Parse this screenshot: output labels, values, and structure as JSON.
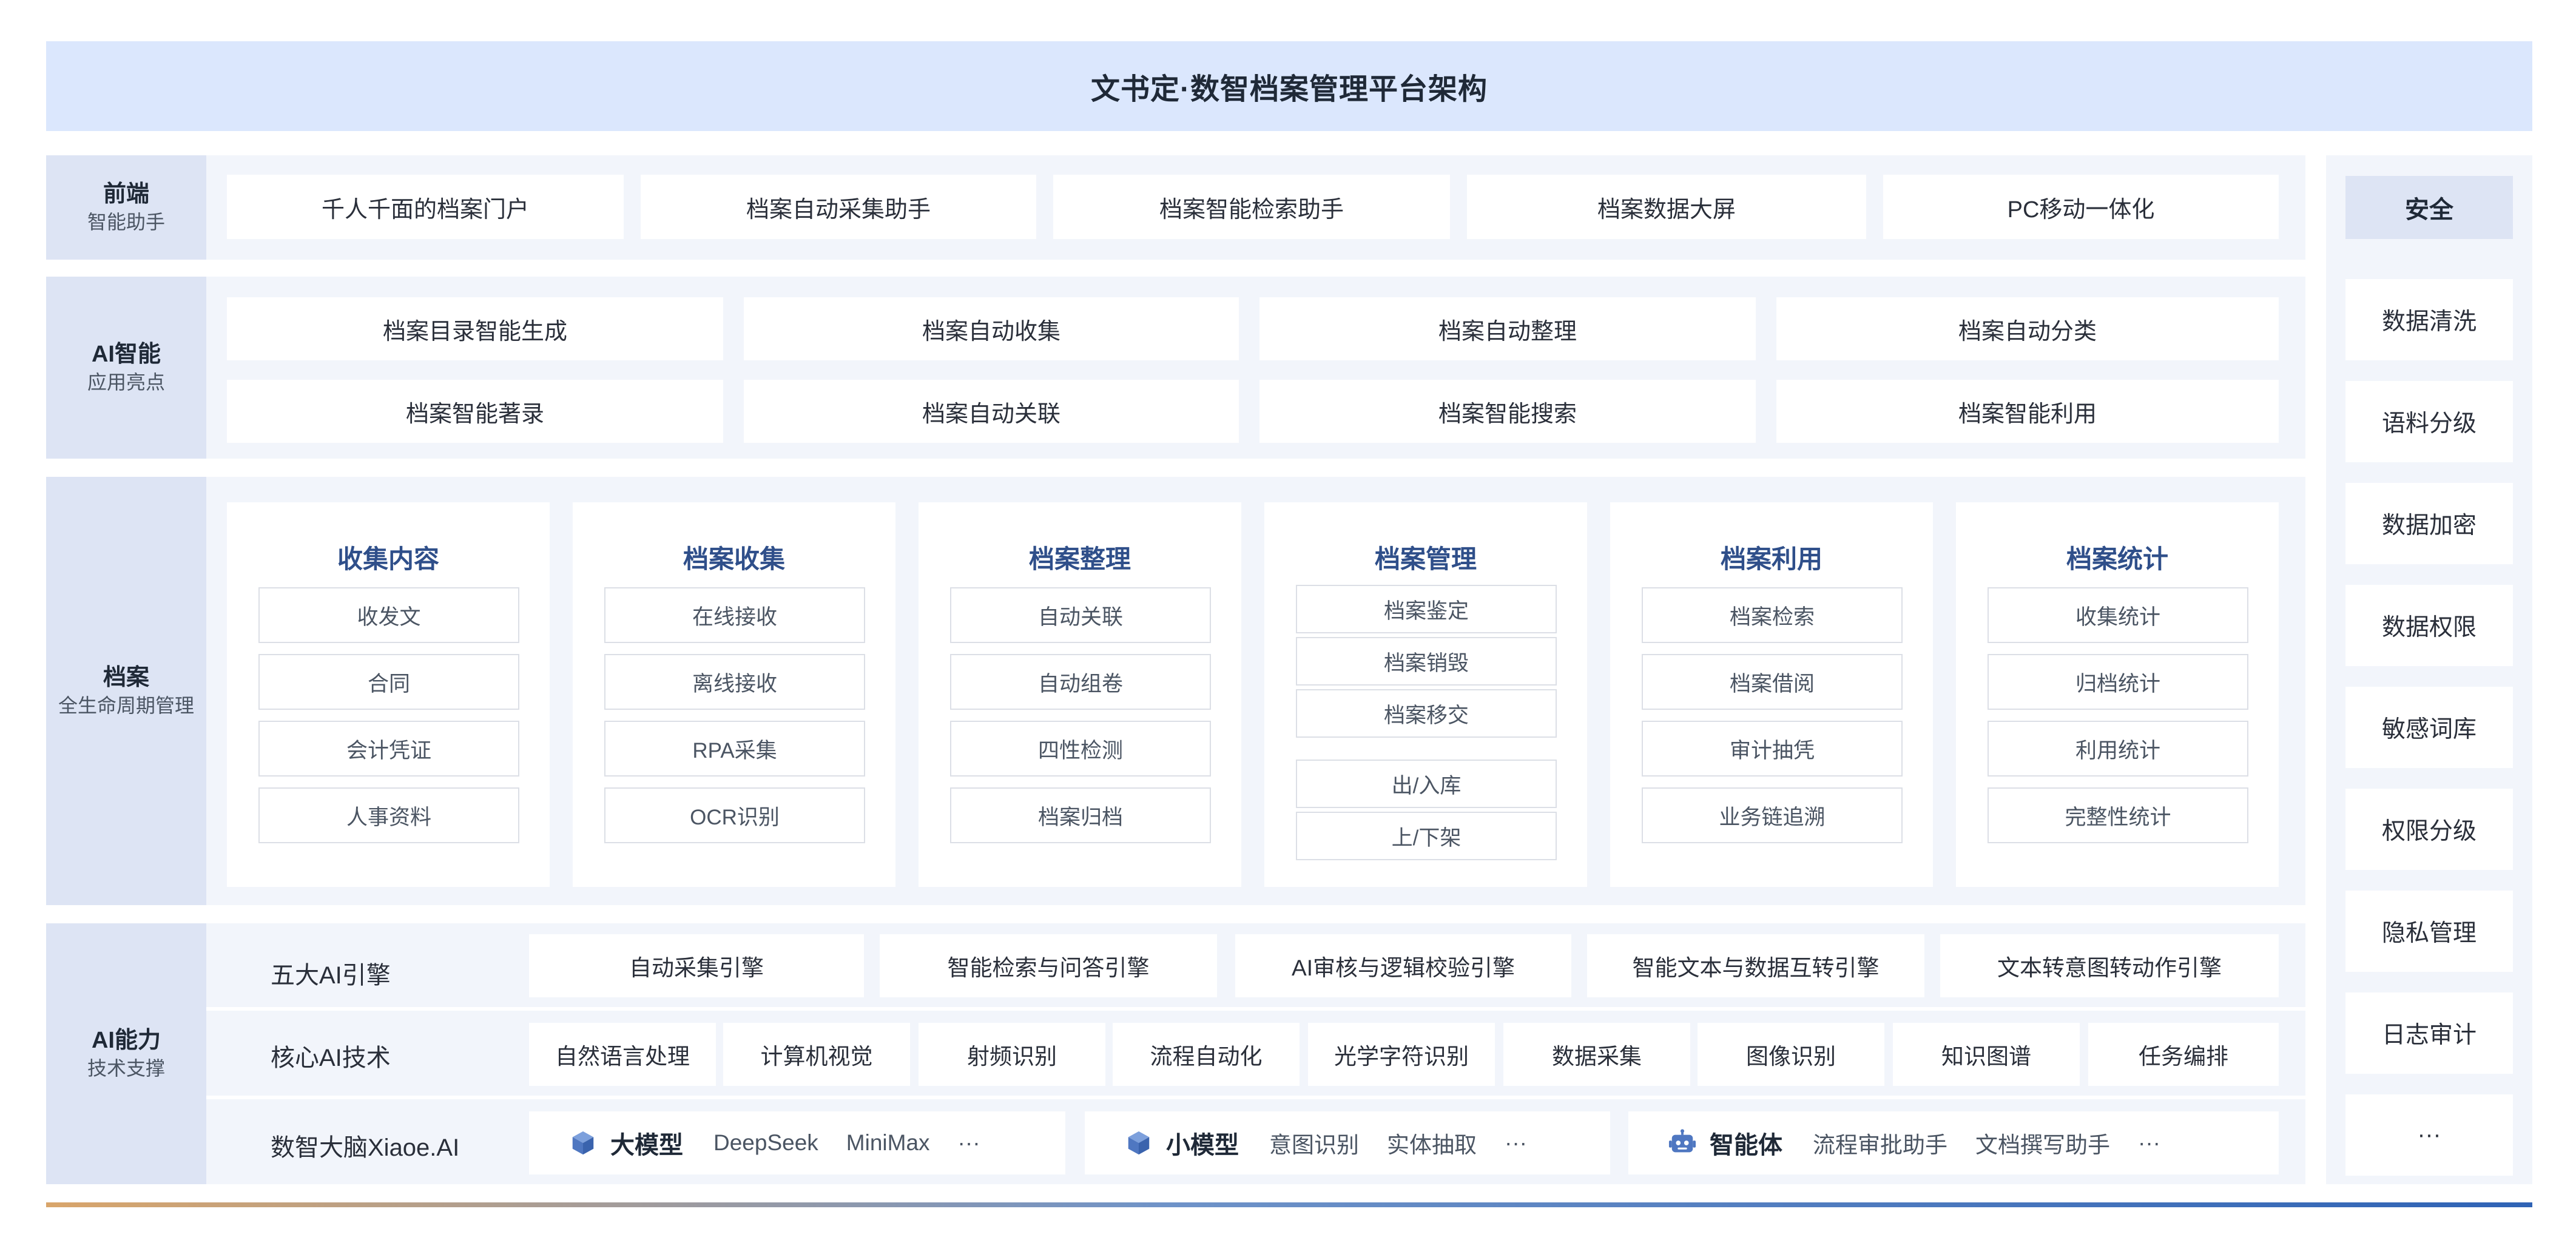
{
  "title": "文书定·数智档案管理平台架构",
  "colors": {
    "title_bg": "#dbe7fd",
    "label_bg": "#dde4f4",
    "row_bg": "#f2f5fb",
    "card_title": "#2f4f8a",
    "icon_blue": "#5b84c9"
  },
  "frontend": {
    "label": "前端",
    "sublabel": "智能助手",
    "items": [
      "千人千面的档案门户",
      "档案自动采集助手",
      "档案智能检索助手",
      "档案数据大屏",
      "PC移动一体化"
    ]
  },
  "ai_apps": {
    "label": "AI智能",
    "sublabel": "应用亮点",
    "row1": [
      "档案目录智能生成",
      "档案自动收集",
      "档案自动整理",
      "档案自动分类"
    ],
    "row2": [
      "档案智能著录",
      "档案自动关联",
      "档案智能搜索",
      "档案智能利用"
    ]
  },
  "archive": {
    "label": "档案",
    "sublabel": "全生命周期管理",
    "cards": [
      {
        "title": "收集内容",
        "items": [
          "收发文",
          "合同",
          "会计凭证",
          "人事资料"
        ]
      },
      {
        "title": "档案收集",
        "items": [
          "在线接收",
          "离线接收",
          "RPA采集",
          "OCR识别"
        ]
      },
      {
        "title": "档案整理",
        "items": [
          "自动关联",
          "自动组卷",
          "四性检测",
          "档案归档"
        ]
      },
      {
        "title": "档案管理",
        "items": [
          "档案鉴定",
          "档案销毁",
          "档案移交",
          "出/入库",
          "上/下架"
        ]
      },
      {
        "title": "档案利用",
        "items": [
          "档案检索",
          "档案借阅",
          "审计抽凭",
          "业务链追溯"
        ]
      },
      {
        "title": "档案统计",
        "items": [
          "收集统计",
          "归档统计",
          "利用统计",
          "完整性统计"
        ]
      }
    ]
  },
  "ai_capability": {
    "label": "AI能力",
    "sublabel": "技术支撑",
    "engines_label": "五大AI引擎",
    "engines": [
      "自动采集引擎",
      "智能检索与问答引擎",
      "AI审核与逻辑校验引擎",
      "智能文本与数据互转引擎",
      "文本转意图转动作引擎"
    ],
    "core_label": "核心AI技术",
    "core": [
      "自然语言处理",
      "计算机视觉",
      "射频识别",
      "流程自动化",
      "光学字符识别",
      "数据采集",
      "图像识别",
      "知识图谱",
      "任务编排"
    ],
    "brain_label": "数智大脑Xiaoe.AI",
    "groups": [
      {
        "icon": "cube-icon",
        "name": "大模型",
        "items": [
          "DeepSeek",
          "MiniMax",
          "···"
        ]
      },
      {
        "icon": "cube-icon",
        "name": "小模型",
        "items": [
          "意图识别",
          "实体抽取",
          "···"
        ]
      },
      {
        "icon": "robot-icon",
        "name": "智能体",
        "items": [
          "流程审批助手",
          "文档撰写助手",
          "···"
        ]
      }
    ]
  },
  "security": {
    "title": "安全",
    "items": [
      "数据清洗",
      "语料分级",
      "数据加密",
      "数据权限",
      "敏感词库",
      "权限分级",
      "隐私管理",
      "日志审计",
      "···"
    ]
  }
}
